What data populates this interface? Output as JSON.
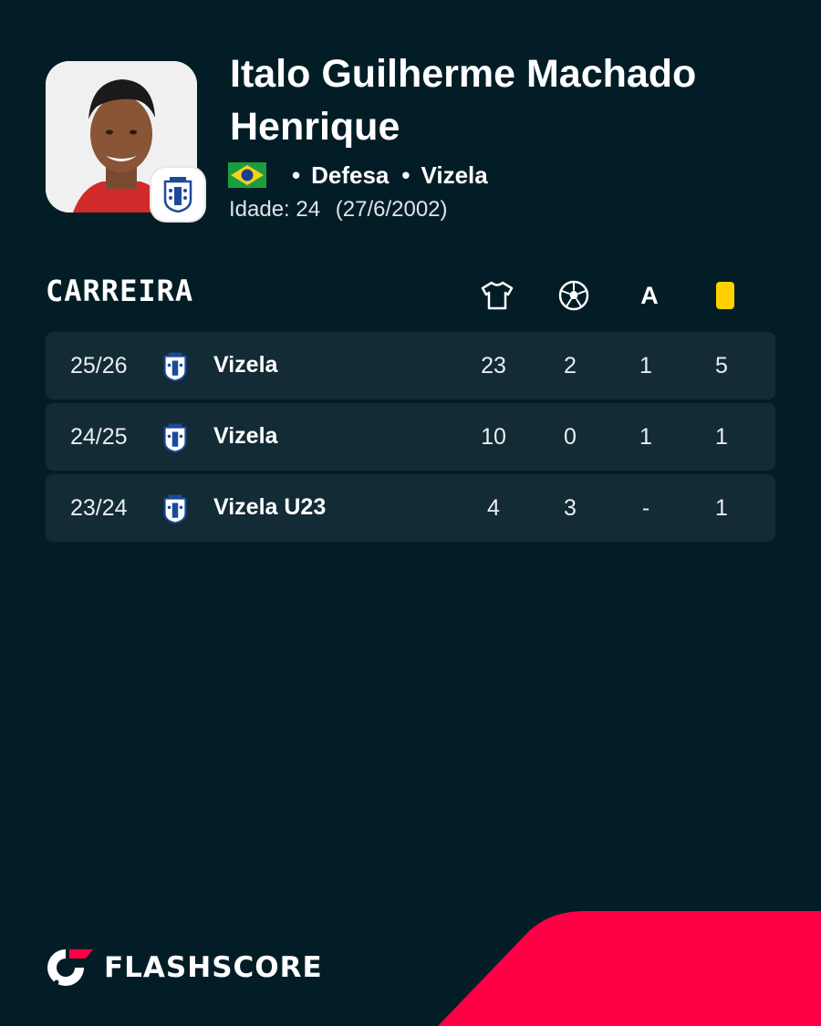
{
  "player": {
    "name": "Italo Guilherme Machado Henrique",
    "position": "Defesa",
    "club": "Vizela",
    "age_label": "Idade: 24",
    "birth_date": "(27/6/2002)",
    "nationality_flag": "brazil-flag-icon"
  },
  "section": {
    "title": "CARREIRA",
    "columns": [
      {
        "icon": "shirt-icon"
      },
      {
        "icon": "soccer-ball-icon"
      },
      {
        "icon": "assist-icon",
        "label": "A"
      },
      {
        "icon": "yellow-card-icon",
        "color": "#ffd000"
      }
    ]
  },
  "career": [
    {
      "season": "25/26",
      "club": "Vizela",
      "apps": "23",
      "goals": "2",
      "assists": "1",
      "yellow": "5"
    },
    {
      "season": "24/25",
      "club": "Vizela",
      "apps": "10",
      "goals": "0",
      "assists": "1",
      "yellow": "1"
    },
    {
      "season": "23/24",
      "club": "Vizela U23",
      "apps": "4",
      "goals": "3",
      "assists": "-",
      "yellow": "1"
    }
  ],
  "brand": {
    "name": "FLASHSCORE",
    "accent": "#ff0046",
    "background": "#031d27"
  }
}
